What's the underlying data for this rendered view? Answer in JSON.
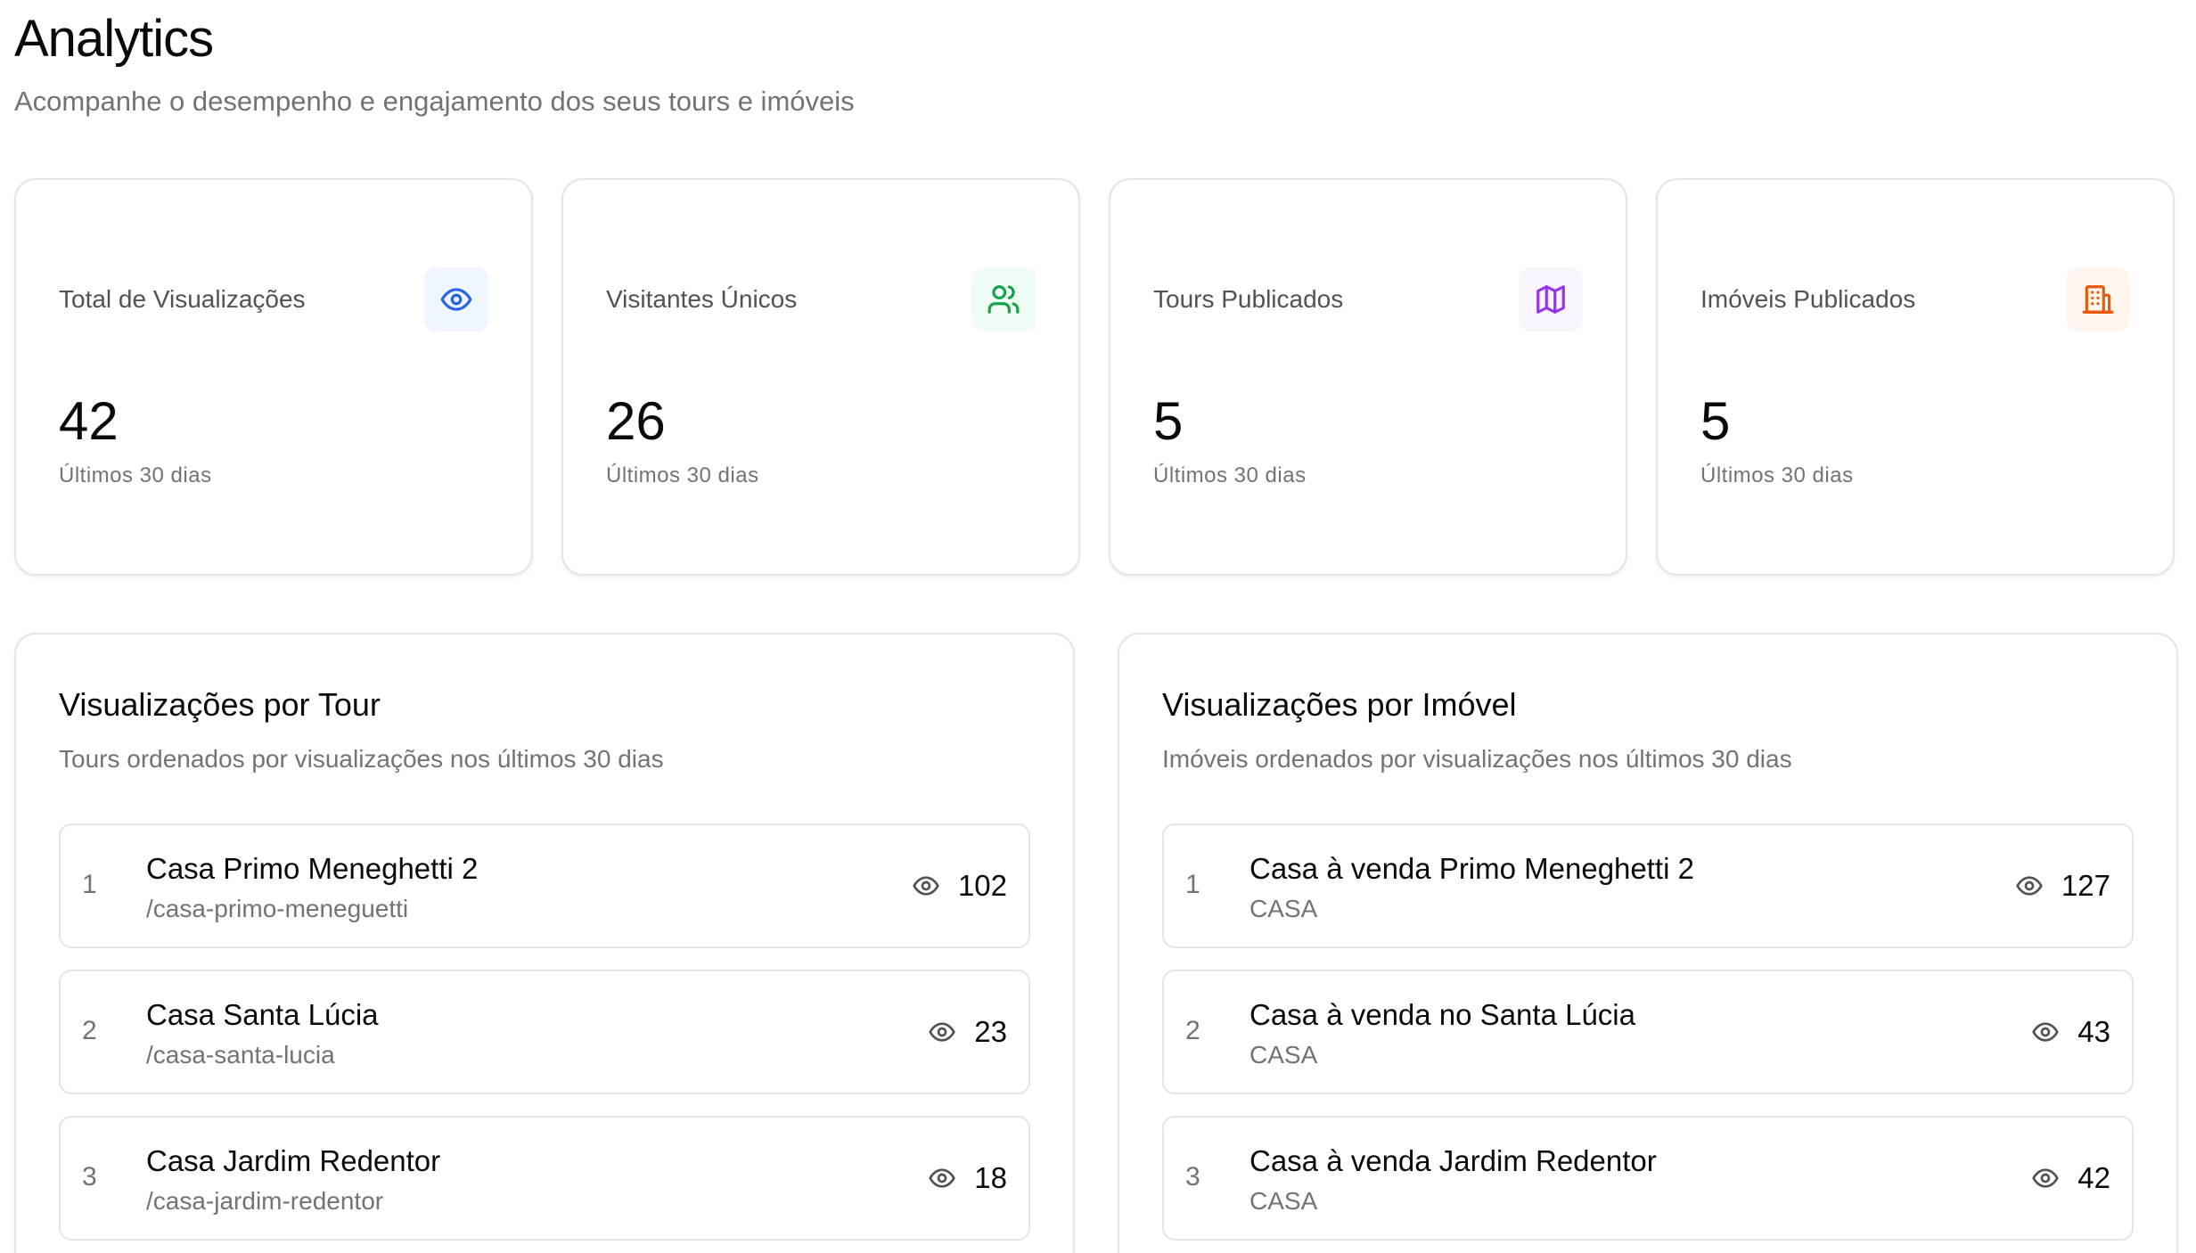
{
  "header": {
    "title": "Analytics",
    "subtitle": "Acompanhe o desempenho e engajamento dos seus tours e imóveis"
  },
  "stats": [
    {
      "label": "Total de Visualizações",
      "value": "42",
      "note": "Últimos 30 dias",
      "icon": "eye-icon",
      "icon_color": "#2563eb",
      "icon_bg": "#eff6ff"
    },
    {
      "label": "Visitantes Únicos",
      "value": "26",
      "note": "Últimos 30 dias",
      "icon": "users-icon",
      "icon_color": "#16a34a",
      "icon_bg": "#f0fdf4"
    },
    {
      "label": "Tours Publicados",
      "value": "5",
      "note": "Últimos 30 dias",
      "icon": "map-icon",
      "icon_color": "#9333ea",
      "icon_bg": "#faf5ff"
    },
    {
      "label": "Imóveis Publicados",
      "value": "5",
      "note": "Últimos 30 dias",
      "icon": "building-icon",
      "icon_color": "#ea580c",
      "icon_bg": "#fff7ed"
    }
  ],
  "tours_panel": {
    "title": "Visualizações por Tour",
    "subtitle": "Tours ordenados por visualizações nos últimos 30 dias",
    "rows": [
      {
        "rank": "1",
        "name": "Casa Primo Meneghetti 2",
        "sub": "/casa-primo-meneguetti",
        "views": "102"
      },
      {
        "rank": "2",
        "name": "Casa Santa Lúcia",
        "sub": "/casa-santa-lucia",
        "views": "23"
      },
      {
        "rank": "3",
        "name": "Casa Jardim Redentor",
        "sub": "/casa-jardim-redentor",
        "views": "18"
      }
    ]
  },
  "properties_panel": {
    "title": "Visualizações por Imóvel",
    "subtitle": "Imóveis ordenados por visualizações nos últimos 30 dias",
    "rows": [
      {
        "rank": "1",
        "name": "Casa à venda Primo Meneghetti 2",
        "sub": "CASA",
        "views": "127"
      },
      {
        "rank": "2",
        "name": "Casa à venda no Santa Lúcia",
        "sub": "CASA",
        "views": "43"
      },
      {
        "rank": "3",
        "name": "Casa à venda Jardim Redentor",
        "sub": "CASA",
        "views": "42"
      }
    ]
  }
}
